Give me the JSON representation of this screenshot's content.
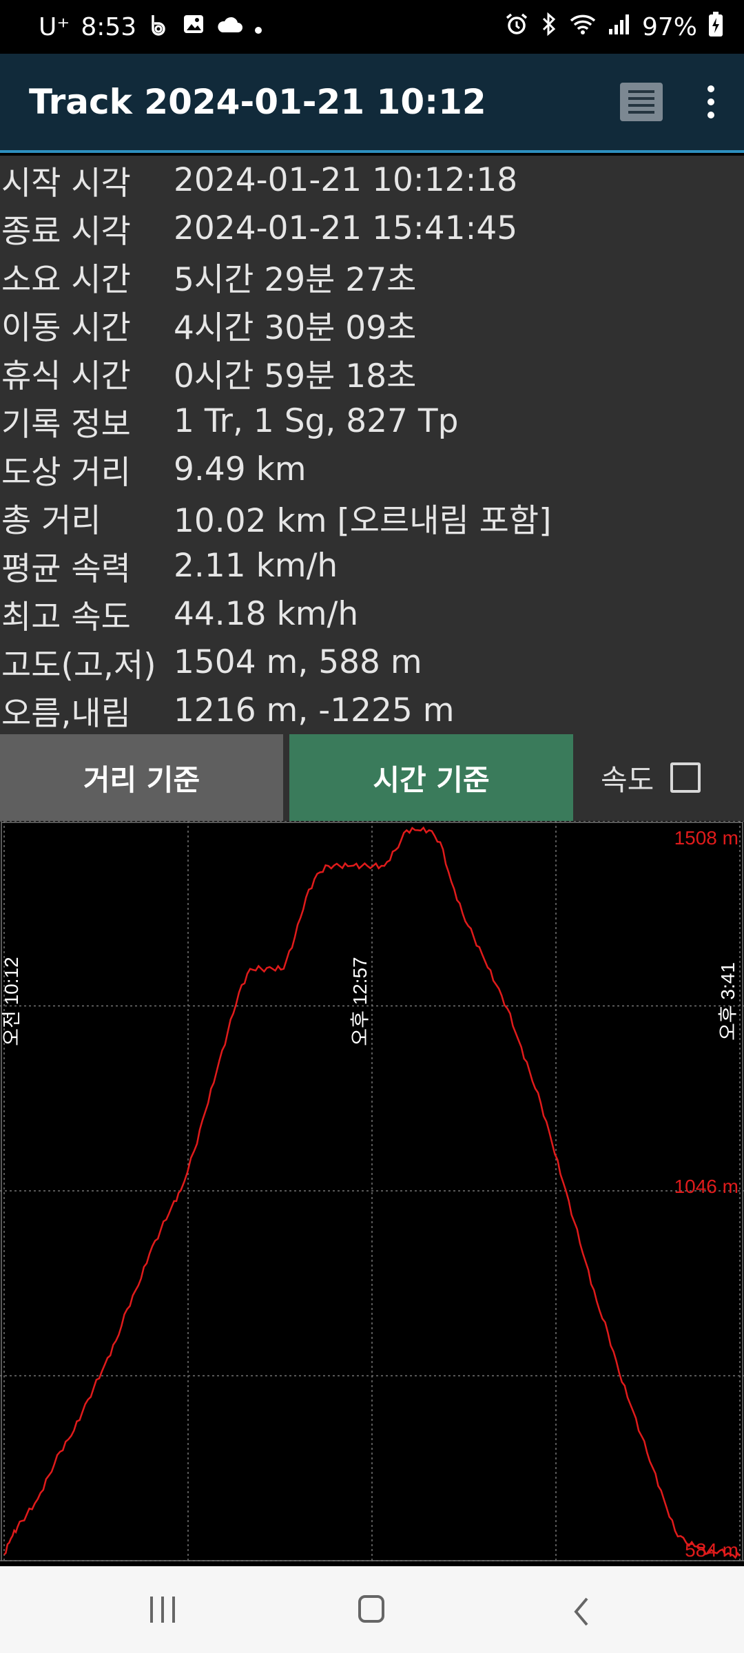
{
  "status_bar": {
    "carrier": "U⁺",
    "time": "8:53",
    "battery": "97%",
    "icons_left": [
      "bixby-icon",
      "gallery-icon",
      "cloud-icon",
      "dot-icon"
    ],
    "icons_right": [
      "alarm-icon",
      "bluetooth-icon",
      "wifi-icon",
      "signal-icon",
      "battery-charging-icon"
    ]
  },
  "appbar": {
    "title": "Track 2024-01-21 10:12",
    "icons": [
      "list-icon",
      "more-vert-icon"
    ]
  },
  "info": [
    {
      "label": "시작 시각",
      "value": "2024-01-21 10:12:18"
    },
    {
      "label": "종료 시각",
      "value": "2024-01-21 15:41:45"
    },
    {
      "label": "소요 시간",
      "value": "5시간 29분 27초"
    },
    {
      "label": "이동 시간",
      "value": "4시간 30분 09초"
    },
    {
      "label": "휴식 시간",
      "value": "0시간 59분 18초"
    },
    {
      "label": "기록 정보",
      "value": "1 Tr, 1 Sg, 827 Tp"
    },
    {
      "label": "도상 거리",
      "value": "9.49 km"
    },
    {
      "label": "총 거리",
      "value": "10.02 km [오르내림 포함]"
    },
    {
      "label": "평균 속력",
      "value": "2.11 km/h"
    },
    {
      "label": "최고 속도",
      "value": "44.18 km/h"
    },
    {
      "label": "고도(고,저)",
      "value": "1504 m, 588 m"
    },
    {
      "label": "오름,내림",
      "value": "1216 m, -1225 m"
    }
  ],
  "toggles": {
    "distance_label": "거리 기준",
    "time_label": "시간 기준",
    "speed_label": "속도",
    "selected": "time",
    "speed_checked": false
  },
  "chart_data": {
    "type": "line",
    "x_tick_labels": [
      "오전 10:12",
      "오후 12:57",
      "오후 3:41"
    ],
    "y_tick_labels": [
      "1508 m",
      "1046 m",
      "584 m"
    ],
    "ylim": [
      584,
      1508
    ],
    "xlim": [
      "10:12",
      "15:41"
    ],
    "grid": true,
    "line_color": "#e01b1b",
    "series": [
      {
        "x_minutes": [
          0,
          3,
          6,
          10,
          15,
          20,
          25,
          30,
          35,
          40,
          45,
          50,
          55,
          60,
          65,
          70,
          75,
          79,
          85,
          90,
          95,
          100,
          105,
          110,
          115,
          120,
          125,
          130,
          135,
          140,
          145,
          150,
          155,
          160,
          165,
          170,
          175,
          180,
          185,
          190,
          195,
          200,
          205,
          210,
          215,
          220,
          225,
          230,
          235,
          240,
          245,
          250,
          255,
          260,
          265,
          270,
          275,
          280,
          285,
          290,
          295,
          300,
          305,
          310,
          315,
          320,
          325,
          329
        ],
        "y": [
          590,
          610,
          625,
          640,
          660,
          690,
          720,
          740,
          770,
          800,
          830,
          860,
          900,
          930,
          970,
          1000,
          1030,
          1050,
          1100,
          1150,
          1200,
          1250,
          1300,
          1330,
          1330,
          1330,
          1330,
          1370,
          1420,
          1450,
          1460,
          1460,
          1460,
          1460,
          1460,
          1460,
          1480,
          1505,
          1505,
          1505,
          1490,
          1440,
          1400,
          1370,
          1340,
          1310,
          1280,
          1240,
          1200,
          1160,
          1110,
          1060,
          1010,
          960,
          910,
          870,
          820,
          780,
          740,
          700,
          660,
          620,
          605,
          600,
          592,
          595,
          590,
          588
        ]
      }
    ]
  },
  "navbar": {
    "icons": [
      "recents-icon",
      "home-icon",
      "back-icon"
    ]
  }
}
